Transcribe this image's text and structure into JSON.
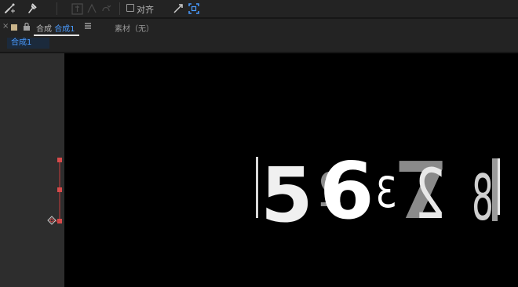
{
  "toolbar": {
    "snap_label": "对齐"
  },
  "panel": {
    "comp_prefix": "合成",
    "comp_name": "合成1",
    "footage_label": "素材（无）"
  },
  "breadcrumb": {
    "item": "合成1"
  },
  "colors": {
    "accent": "#4a9bff",
    "label_swatch": "#c9b48a",
    "path": "#c83a3a",
    "canvas": "#000000"
  },
  "canvas_text": {
    "digits": [
      "5",
      "2",
      "6",
      "3",
      "7",
      "2",
      "8"
    ]
  }
}
